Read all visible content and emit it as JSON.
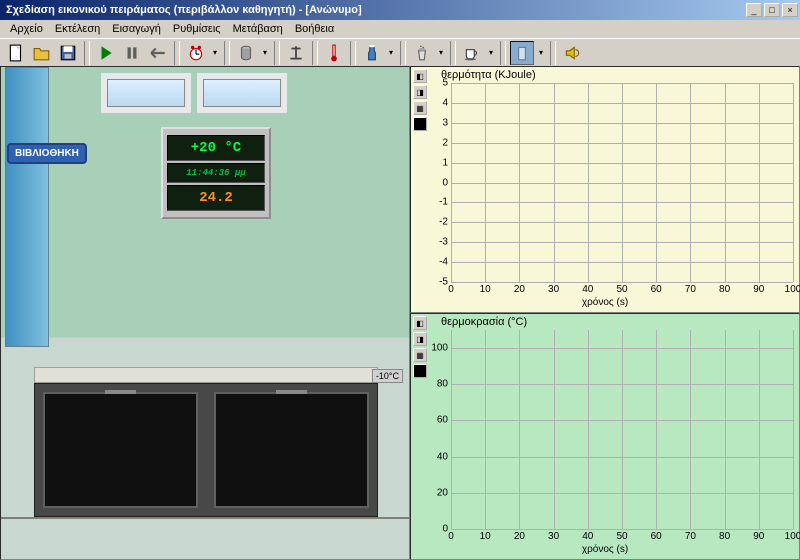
{
  "window": {
    "title": "Σχεδίαση εικονικού πειράματος (περιβάλλον καθηγητή) - [Ανώνυμο]"
  },
  "menu": {
    "file": "Αρχείο",
    "run": "Εκτέλεση",
    "insert": "Εισαγωγή",
    "settings": "Ρυθμίσεις",
    "goto": "Μετάβαση",
    "help": "Βοήθεια"
  },
  "scene": {
    "library_label": "ΒΙΒΛΙΟΘΗΚΗ",
    "temperature": "+20 °C",
    "clock": "11:44:36 μμ",
    "reading": "24.2",
    "fridge_label": "-10°C"
  },
  "chart_data": [
    {
      "type": "line",
      "title": "θερμότητα (KJoule)",
      "xlabel": "χρόνος (s)",
      "ylabel": "",
      "x_ticks": [
        0,
        10,
        20,
        30,
        40,
        50,
        60,
        70,
        80,
        90,
        100
      ],
      "y_ticks": [
        -5,
        -4,
        -3,
        -2,
        -1,
        0,
        1,
        2,
        3,
        4,
        5
      ],
      "xlim": [
        0,
        100
      ],
      "ylim": [
        -5,
        5
      ],
      "series": []
    },
    {
      "type": "line",
      "title": "θερμοκρασία (°C)",
      "xlabel": "χρόνος (s)",
      "ylabel": "",
      "x_ticks": [
        0,
        10,
        20,
        30,
        40,
        50,
        60,
        70,
        80,
        90,
        100
      ],
      "y_ticks": [
        0,
        20,
        40,
        60,
        80,
        100
      ],
      "xlim": [
        0,
        100
      ],
      "ylim": [
        0,
        110
      ],
      "series": []
    }
  ]
}
